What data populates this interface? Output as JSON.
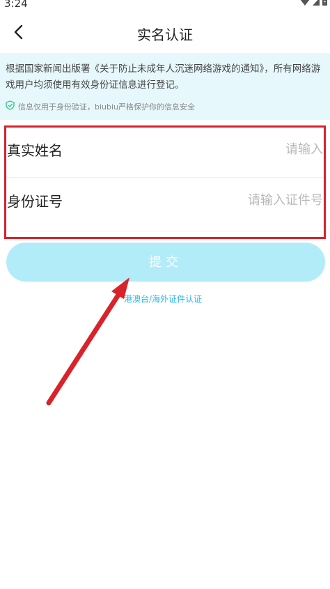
{
  "status_bar": {
    "time": "3:24"
  },
  "nav": {
    "title": "实名认证"
  },
  "notice": {
    "text": "根据国家新闻出版署《关于防止未成年人沉迷网络游戏的通知》，所有网络游戏用户均须使用有效身份证信息进行登记。",
    "safe_text": "信息仅用于身份验证，biubiu严格保护你的信息安全"
  },
  "form": {
    "name_label": "真实姓名",
    "name_placeholder": "请输入",
    "id_label": "身份证号",
    "id_placeholder": "请输入证件号"
  },
  "submit_label": "提交",
  "alt_link": "港澳台/海外证件认证",
  "colors": {
    "accent": "#25b8e6",
    "notice_bg": "#e7f8fc",
    "button_bg": "#b3ecf9",
    "annotation_red": "#d9222a"
  }
}
